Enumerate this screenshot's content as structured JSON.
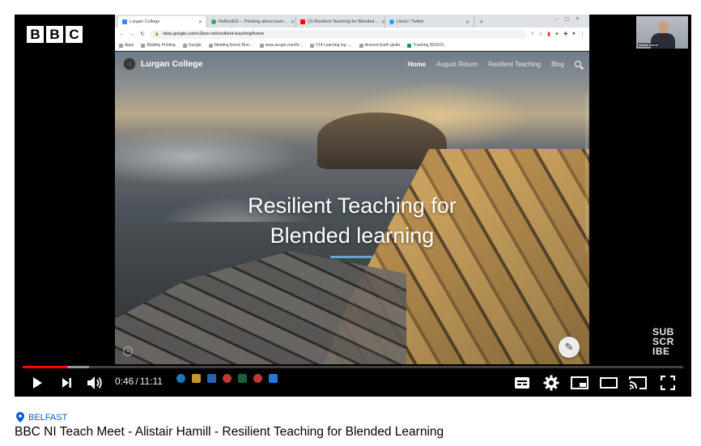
{
  "player": {
    "channel_logo": [
      "B",
      "B",
      "C"
    ],
    "subscribe_watermark": [
      "SUB",
      "SCR",
      "IBE"
    ],
    "webcam_caption": "Alistair Hamill",
    "time": {
      "current": "0:46",
      "separator": "/",
      "duration": "11:11"
    },
    "progress": {
      "played_fraction": 0.068,
      "loaded_fraction": 0.1
    },
    "controls": {
      "play": "play-icon",
      "next": "next-icon",
      "volume": "volume-icon",
      "captions": "captions-icon",
      "settings": "settings-icon",
      "miniplayer": "miniplayer-icon",
      "theater": "theater-icon",
      "cast": "cast-icon",
      "fullscreen": "fullscreen-icon"
    },
    "accent_color": "#ff0000"
  },
  "browser": {
    "tabs": [
      {
        "label": "Lurgan College",
        "color": "#4285f4"
      },
      {
        "label": "ReflectED – Thinking about learn…",
        "color": "#34a853"
      },
      {
        "label": "(2) Resilient Teaching for Blended…",
        "color": "#ff0000"
      },
      {
        "label": "Liked / Twitter",
        "color": "#1da1f2"
      }
    ],
    "url": "sites.google.com/c2ken.net/resilient-teaching/home",
    "bookmarks": [
      "Apps",
      "Mobility Printing",
      "Google",
      "Meeting Room Boo...",
      "www.arcgis.com/fe...",
      "Y14 Learning log -...",
      "Ancient Earth globe",
      "Tracking 2020/21"
    ]
  },
  "site": {
    "brand": "Lurgan College",
    "nav": [
      {
        "label": "Home",
        "active": true
      },
      {
        "label": "August Return",
        "active": false
      },
      {
        "label": "Resilient Teaching",
        "active": false
      },
      {
        "label": "Blog",
        "active": false
      }
    ],
    "hero_lines": [
      "Resilient Teaching for",
      "Blended learning"
    ],
    "accent_color": "#5fa8d3"
  },
  "video": {
    "location": "BELFAST",
    "title": "BBC NI Teach Meet - Alistair Hamill - Resilient Teaching for Blended Learning",
    "location_color": "#065fd4"
  }
}
